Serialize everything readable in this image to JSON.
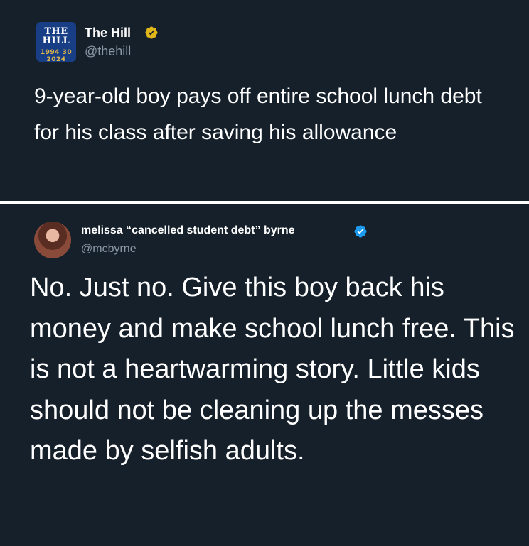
{
  "post_1": {
    "avatar_logo": {
      "line1": "THE",
      "line2": "HILL",
      "line3": "1994 30 2024"
    },
    "display_name": "The Hill",
    "badge": "verified-gold-badge-icon",
    "handle": "@thehill",
    "text": "9-year-old boy pays off entire school lunch debt for his class after saving his allowance"
  },
  "post_2": {
    "display_name": "melissa “cancelled student debt” byrne",
    "badge": "verified-blue-badge-icon",
    "handle": "@mcbyrne",
    "text": "No. Just no. Give this boy back his money and make school lunch free. This is not a heartwarming story. Little kids should not be cleaning up the messes made by selfish adults."
  },
  "colors": {
    "background": "#15202b",
    "divider": "#ffffff",
    "text": "#ffffff",
    "secondary_text": "#8b98a5",
    "gold_badge": "#e2b719",
    "blue_badge": "#1d9bf0",
    "hill_logo_bg": "#183f86"
  }
}
